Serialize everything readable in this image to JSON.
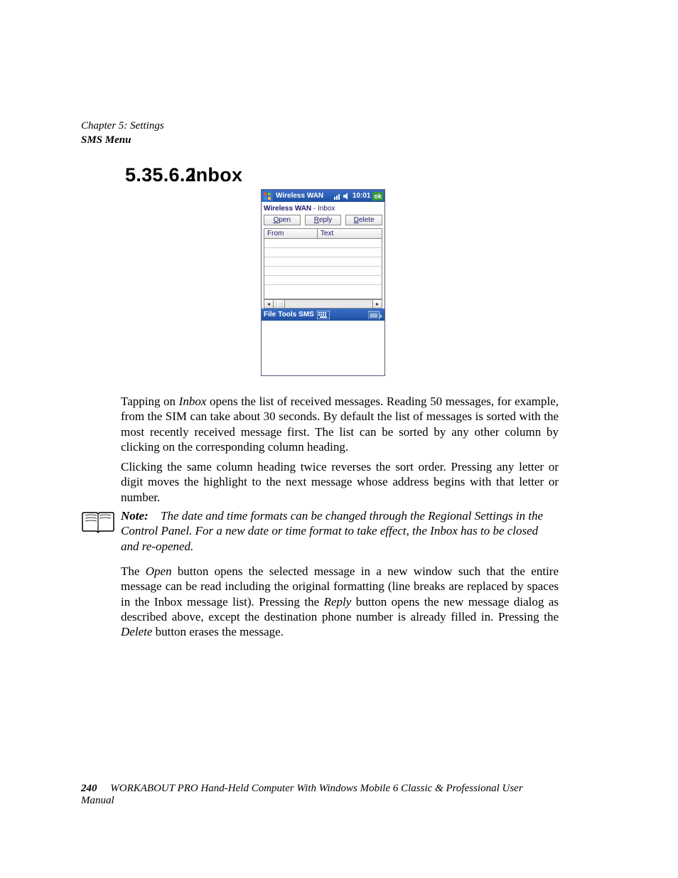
{
  "header": {
    "chapter": "Chapter 5: Settings",
    "subtitle": "SMS Menu"
  },
  "section": {
    "number": "5.35.6.2",
    "title": "Inbox"
  },
  "screenshot": {
    "titlebar_title": "Wireless WAN",
    "time": "10:01",
    "ok": "ok",
    "subtitle_bold": "Wireless WAN",
    "subtitle_rest": " - Inbox",
    "buttons": {
      "open": "pen",
      "open_u": "O",
      "reply": "eply",
      "reply_u": "R",
      "delete": "elete",
      "delete_u": "D"
    },
    "columns": {
      "from": "From",
      "text": "Text"
    },
    "bottombar": {
      "file": "File",
      "tools": "Tools",
      "sms": "SMS"
    }
  },
  "paragraphs": {
    "p1_a": "Tapping on ",
    "p1_inbox": "Inbox",
    "p1_b": " opens the list of received messages. Reading 50 messages, for example, from the SIM can take about 30 seconds. By default the list of messages is sorted with the most recently received message first. The list can be sorted by any other column by clicking on the corresponding column heading.",
    "p2": "Clicking the same column heading twice reverses the sort order. Pressing any letter or digit moves the highlight to the next message whose address begins with that letter or number.",
    "note_label": "Note:",
    "note_body": "The date and time formats can be changed through the Regional Settings in the Control Panel. For a new date or time format to take effect, the Inbox has to be closed and re-opened.",
    "p3_a": "The ",
    "p3_open": "Open",
    "p3_b": " button opens the selected message in a new window such that the entire message can be read including the original formatting (line breaks are replaced by spaces in the Inbox message list). Pressing the ",
    "p3_reply": "Reply",
    "p3_c": " button opens the new message dialog as described above, except the destination phone number is already filled in. Pressing the ",
    "p3_delete": "Delete",
    "p3_d": " button erases the message."
  },
  "footer": {
    "page": "240",
    "title": "WORKABOUT PRO Hand-Held Computer With Windows Mobile 6 Classic & Professional User Manual"
  }
}
